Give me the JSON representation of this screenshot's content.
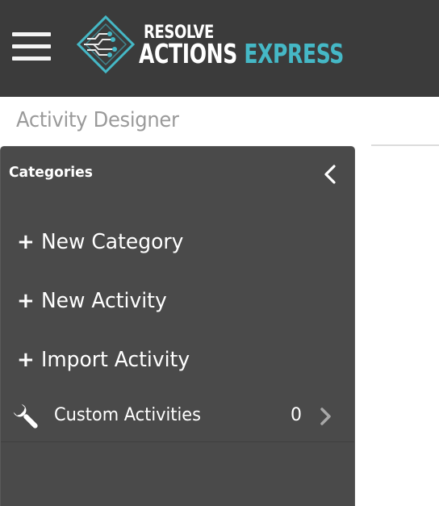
{
  "header": {
    "menu_icon": "hamburger-icon",
    "logo_icon": "circuit-diamond-logo-icon",
    "logo_top": "RESOLVE",
    "logo_bottom_1": "ACTIONS",
    "logo_bottom_2": "EXPRESS",
    "colors": {
      "background": "#3b3b3b",
      "accent": "#45b8c6"
    }
  },
  "page": {
    "title": "Activity Designer"
  },
  "panel": {
    "title": "Categories",
    "collapse_icon": "chevron-left-icon",
    "actions": [
      {
        "icon": "plus-icon",
        "symbol": "+",
        "label": "New Category"
      },
      {
        "icon": "plus-icon",
        "symbol": "+",
        "label": "New Activity"
      },
      {
        "icon": "plus-icon",
        "symbol": "+",
        "label": "Import Activity"
      }
    ],
    "custom": {
      "icon": "wrench-icon",
      "label": "Custom Activities",
      "count": "0",
      "chevron_icon": "chevron-right-icon"
    },
    "colors": {
      "background": "#4a4a4a"
    }
  }
}
